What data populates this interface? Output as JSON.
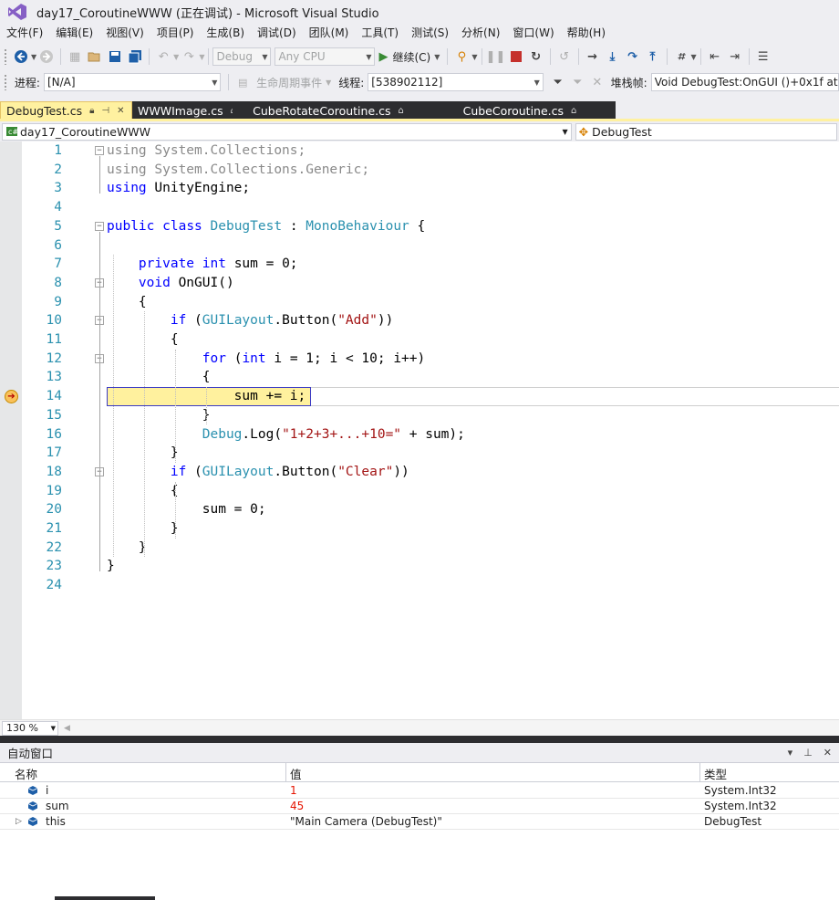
{
  "window": {
    "title": "day17_CoroutineWWW (正在调试) - Microsoft Visual Studio"
  },
  "menu": [
    "文件(F)",
    "编辑(E)",
    "视图(V)",
    "项目(P)",
    "生成(B)",
    "调试(D)",
    "团队(M)",
    "工具(T)",
    "测试(S)",
    "分析(N)",
    "窗口(W)",
    "帮助(H)"
  ],
  "toolbar": {
    "config": "Debug",
    "platform": "Any CPU",
    "continue_label": "继续(C)"
  },
  "debug_location": {
    "process_label": "进程:",
    "process_value": "[N/A]",
    "lifecycle_label": "生命周期事件",
    "thread_label": "线程:",
    "thread_value": "[538902112]",
    "stackframe_label": "堆栈帧:",
    "stackframe_value": "Void DebugTest:OnGUI ()+0x1f at"
  },
  "tabs": [
    {
      "label": "DebugTest.cs",
      "active": true
    },
    {
      "label": "WWWImage.cs",
      "active": false
    },
    {
      "label": "CubeRotateCoroutine.cs",
      "active": false
    },
    {
      "label": "CubeCoroutine.cs",
      "active": false
    }
  ],
  "nav": {
    "project": "day17_CoroutineWWW",
    "class": "DebugTest"
  },
  "code_lines": [
    "using System.Collections;",
    "using System.Collections.Generic;",
    "using UnityEngine;",
    "",
    "public class DebugTest : MonoBehaviour {",
    "",
    "    private int sum = 0;",
    "    void OnGUI()",
    "    {",
    "        if (GUILayout.Button(\"Add\"))",
    "        {",
    "            for (int i = 1; i < 10; i++)",
    "            {",
    "                sum += i;",
    "            }",
    "            Debug.Log(\"1+2+3+...+10=\" + sum);",
    "        }",
    "        if (GUILayout.Button(\"Clear\"))",
    "        {",
    "            sum = 0;",
    "        }",
    "    }",
    "}",
    ""
  ],
  "current_line": 14,
  "zoom": "130 %",
  "autos": {
    "title": "自动窗口",
    "columns": [
      "名称",
      "值",
      "类型"
    ],
    "rows": [
      {
        "name": "i",
        "value": "1",
        "type": "System.Int32",
        "changed": true
      },
      {
        "name": "sum",
        "value": "45",
        "type": "System.Int32",
        "changed": true
      },
      {
        "name": "this",
        "value": "\"Main Camera (DebugTest)\"",
        "type": "DebugTest",
        "changed": false
      }
    ]
  }
}
